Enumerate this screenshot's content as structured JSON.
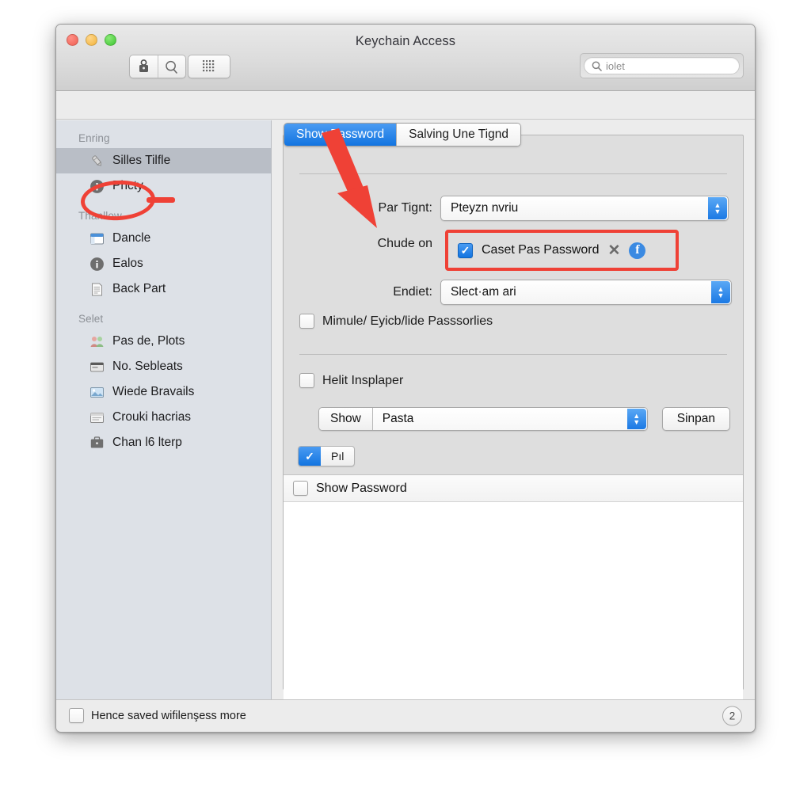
{
  "window": {
    "title": "Keychain Access",
    "traffic_lights": [
      "close",
      "minimize",
      "zoom"
    ],
    "toolbar": {
      "lock_icon": "lock-icon",
      "search_icon": "magnifier-icon",
      "grid_icon": "grid-dots-icon"
    },
    "search": {
      "value": "iolet",
      "icon": "search-icon"
    }
  },
  "sidebar": {
    "groups": [
      {
        "header": "Enring",
        "items": [
          {
            "label": "Silles Tilfle",
            "icon": "pen-icon",
            "selected": true
          },
          {
            "label": "Phcty",
            "icon": "info-circle-icon",
            "selected": false
          }
        ]
      },
      {
        "header": "Thanllow",
        "items": [
          {
            "label": "Dancle",
            "icon": "window-icon",
            "selected": false
          },
          {
            "label": "Ealos",
            "icon": "info-circle-icon",
            "selected": false
          },
          {
            "label": "Back Part",
            "icon": "document-icon",
            "selected": false
          }
        ]
      },
      {
        "header": "Selet",
        "items": [
          {
            "label": "Pas de, Plots",
            "icon": "people-icon",
            "selected": false
          },
          {
            "label": "No. Sebleats",
            "icon": "card-icon",
            "selected": false
          },
          {
            "label": "Wiede Bravails",
            "icon": "photo-icon",
            "selected": false
          },
          {
            "label": "Crouki hacrias",
            "icon": "browser-icon",
            "selected": false
          },
          {
            "label": "Chan l6 lterp",
            "icon": "briefcase-icon",
            "selected": false
          }
        ]
      }
    ]
  },
  "main": {
    "tabs": [
      {
        "label": "Show Password",
        "active": true
      },
      {
        "label": "Salving Une Tignd",
        "active": false
      }
    ],
    "rows": {
      "par_tignt": {
        "label": "Par Tignt:",
        "value": "Pteyzn nvriu",
        "stepper_icon": "stepper-updown-icon"
      },
      "chude_on": {
        "label": "Chude on",
        "checkbox_checked": true,
        "text": "Caset Pas Password",
        "close_icon": "x-icon",
        "facebook_icon": "facebook-icon",
        "highlight_color": "#ef4136"
      },
      "endiet": {
        "label": "Endiet:",
        "value": "Slect·am ari",
        "stepper_icon": "stepper-updown-icon"
      },
      "mimule": {
        "label": "Mimule/ Eyicb/lide Passsorlies",
        "checked": false
      },
      "helit": {
        "label": "Helit Insplaper",
        "checked": false
      },
      "show_combo": {
        "button_label": "Show",
        "value": "Pasta",
        "stepper_icon": "stepper-updown-icon"
      },
      "save_button": "Sinpan",
      "pill": {
        "checked": true,
        "label": "Pıl"
      }
    },
    "list": {
      "header_label": "Show Password",
      "header_checked": false,
      "rows": []
    }
  },
  "footer": {
    "label": "Hence saved wifilenşess more",
    "checked": false,
    "badge": "2"
  },
  "annotations": {
    "arrow_color": "#ef4136",
    "ellipse_color": "#ef4136"
  }
}
